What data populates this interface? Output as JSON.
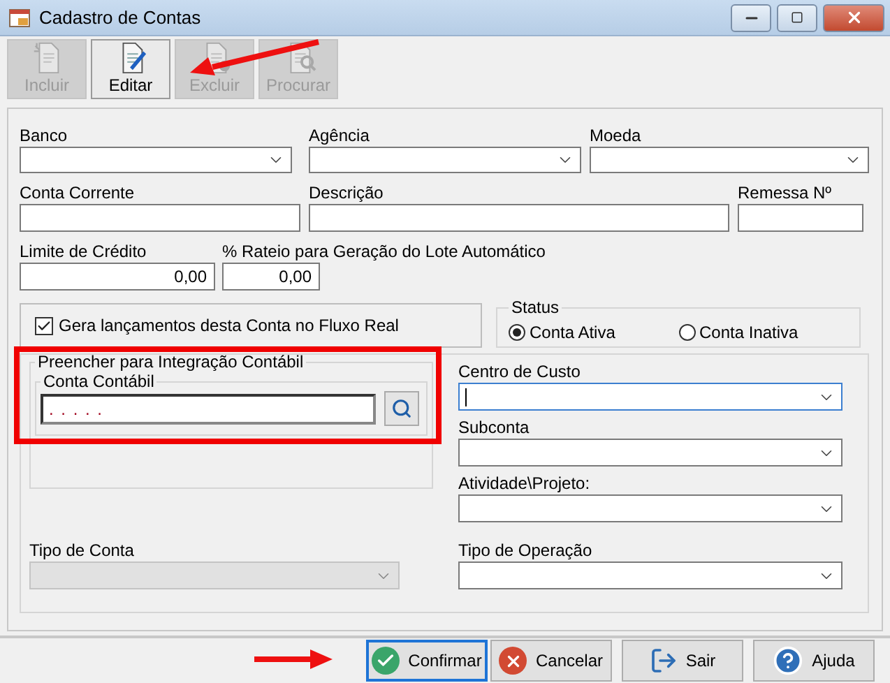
{
  "window": {
    "title": "Cadastro de Contas"
  },
  "toolbar": [
    {
      "label": "Incluir",
      "kind": "new",
      "disabled": true
    },
    {
      "label": "Editar",
      "kind": "edit",
      "disabled": false
    },
    {
      "label": "Excluir",
      "kind": "delete",
      "disabled": true
    },
    {
      "label": "Procurar",
      "kind": "find",
      "disabled": true
    }
  ],
  "rows": [
    [
      {
        "label": "Banco",
        "kind": "select"
      },
      {
        "label": "Agência",
        "kind": "select"
      },
      {
        "label": "Moeda",
        "kind": "select"
      }
    ],
    [
      {
        "label": "Conta Corrente",
        "kind": "input"
      },
      {
        "label": "Descrição",
        "kind": "input"
      },
      {
        "label": "Remessa Nº",
        "kind": "input"
      }
    ],
    [
      {
        "label": "Limite de Crédito",
        "kind": "input",
        "value": "0,00"
      },
      {
        "label": "% Rateio para Geração do Lote Automático",
        "kind": "input",
        "value": "0,00"
      }
    ]
  ],
  "flow_checkbox": {
    "label": "Gera lançamentos desta Conta no Fluxo Real",
    "checked": true
  },
  "status": {
    "title": "Status",
    "options": [
      {
        "label": "Conta Ativa",
        "selected": true
      },
      {
        "label": "Conta Inativa",
        "selected": false
      }
    ]
  },
  "integration": {
    "title": "Preencher para Integração Contábil",
    "account_title": "Conta Contábil",
    "account_value": ". . . . ."
  },
  "right_fields": [
    {
      "label": "Centro de Custo",
      "kind": "select",
      "focused": true
    },
    {
      "label": "Subconta",
      "kind": "select",
      "focused": false
    },
    {
      "label": "Atividade\\Projeto:",
      "kind": "select",
      "focused": false
    }
  ],
  "bottom_fields": [
    {
      "label": "Tipo de Conta",
      "kind": "select",
      "disabled": true
    },
    {
      "label": "Tipo de Operação",
      "kind": "select",
      "disabled": false
    }
  ],
  "buttons": [
    {
      "label": "Confirmar",
      "kind": "confirm",
      "focused": true
    },
    {
      "label": "Cancelar",
      "kind": "cancel",
      "focused": false
    },
    {
      "label": "Sair",
      "kind": "exit",
      "focused": false
    },
    {
      "label": "Ajuda",
      "kind": "help",
      "focused": false
    }
  ]
}
